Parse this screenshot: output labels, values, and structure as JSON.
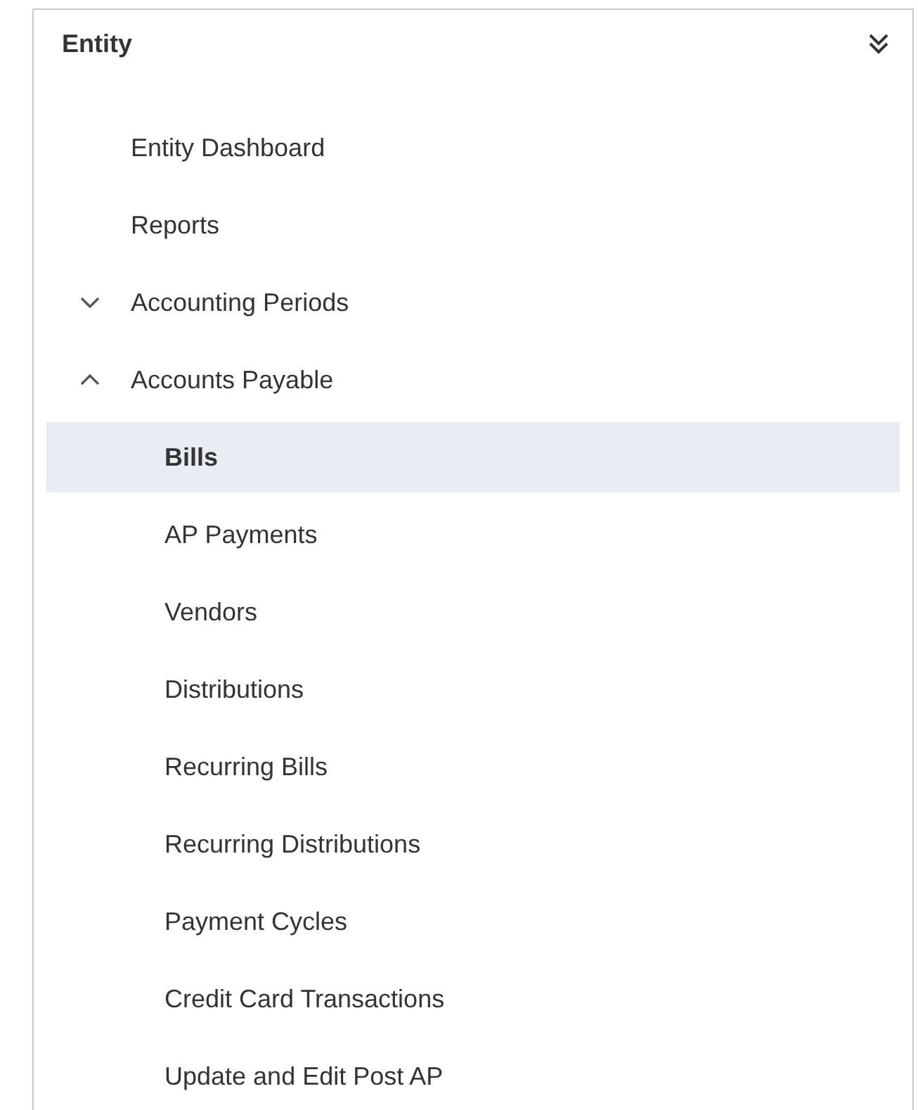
{
  "panel": {
    "title": "Entity"
  },
  "items": [
    {
      "label": "Entity Dashboard",
      "selected": false
    },
    {
      "label": "Reports",
      "selected": false
    },
    {
      "label": "Accounting Periods",
      "selected": false,
      "expanded": false
    },
    {
      "label": "Accounts Payable",
      "selected": false,
      "expanded": true,
      "children": [
        {
          "label": "Bills",
          "selected": true
        },
        {
          "label": "AP Payments",
          "selected": false
        },
        {
          "label": "Vendors",
          "selected": false
        },
        {
          "label": "Distributions",
          "selected": false
        },
        {
          "label": "Recurring Bills",
          "selected": false
        },
        {
          "label": "Recurring Distributions",
          "selected": false
        },
        {
          "label": "Payment Cycles",
          "selected": false
        },
        {
          "label": "Credit Card Transactions",
          "selected": false
        },
        {
          "label": "Update and Edit Post AP",
          "selected": false
        }
      ]
    }
  ]
}
